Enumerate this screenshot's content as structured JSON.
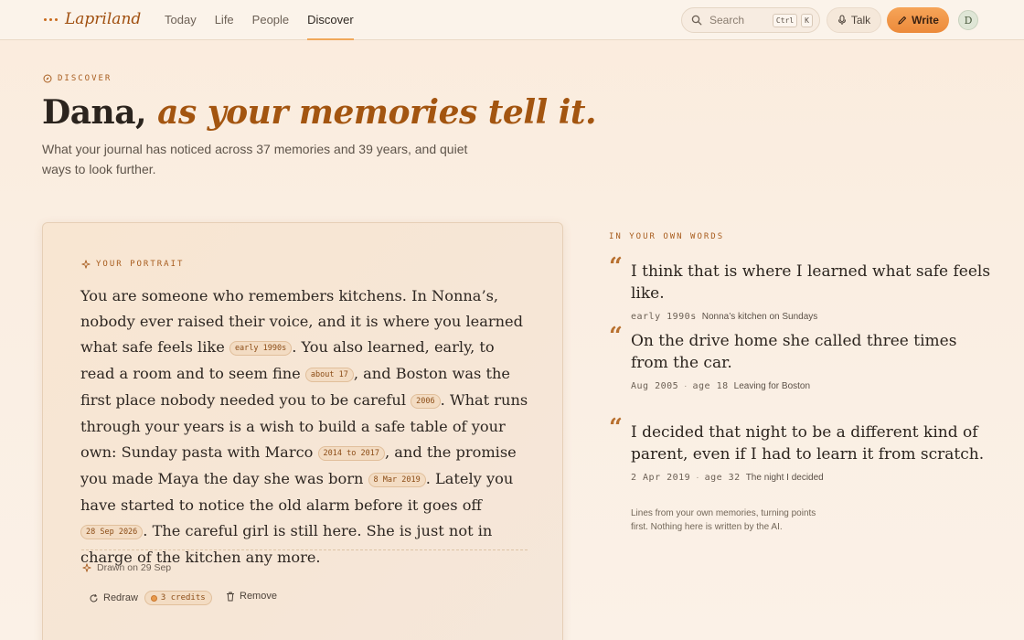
{
  "header": {
    "brand": "Lapriland",
    "nav": [
      {
        "label": "Today"
      },
      {
        "label": "Life"
      },
      {
        "label": "People"
      },
      {
        "label": "Discover",
        "active": true
      }
    ],
    "search": {
      "placeholder": "Search",
      "shortcut_ctrl": "Ctrl",
      "shortcut_key": "K",
      "icon": "search-icon"
    },
    "talk_label": "Talk",
    "write_label": "Write",
    "avatar_initial": "D"
  },
  "hero": {
    "eyebrow": "DISCOVER",
    "title_name": "Dana,",
    "title_emphasis": "as your memories tell it.",
    "subtitle": "What your journal has noticed across 37 memories and 39 years, and quiet ways to look further."
  },
  "portrait": {
    "eyebrow": "YOUR PORTRAIT",
    "text": [
      "You are someone who remembers kitchens. In Nonna’s, nobody ever raised their voice, and it is where you learned what safe feels like ",
      ". You also learned, early, to read a room and to seem fine ",
      ", and Boston was the first place nobody needed you to be careful ",
      ". What runs through your years is a wish to build a safe table of your own: Sunday pasta with Marco ",
      ", and the promise you made Maya the day she was born ",
      ". Lately you have started to notice the old alarm before it goes off ",
      ". The careful girl is still here. She is just not in charge of the kitchen any more."
    ],
    "chips": [
      "early 1990s",
      "about 17",
      "2006",
      "2014 to 2017",
      "8 Mar 2019",
      "28 Sep 2026"
    ],
    "drawn_on": "Drawn on 29 Sep",
    "redraw_label": "Redraw",
    "credits_label": "3 credits",
    "remove_label": "Remove"
  },
  "words": {
    "eyebrow": "IN YOUR OWN WORDS",
    "quotes": [
      {
        "text": "I think that is where I learned what safe feels like.",
        "date": "early 1990s",
        "age": "",
        "source": "Nonna’s kitchen on Sundays"
      },
      {
        "text": "On the drive home she called three times from the car.",
        "date": "Aug 2005",
        "age": "age 18",
        "source": "Leaving for Boston"
      },
      {
        "text": "I decided that night to be a different kind of parent, even if I had to learn it from scratch.",
        "date": "2 Apr 2019",
        "age": "age 32",
        "source": "The night I decided"
      }
    ],
    "note": "Lines from your own memories, turning points first. Nothing here is written by the AI."
  },
  "colors": {
    "accent": "#a35510",
    "write_button": "#ec8a3a",
    "chip_bg": "#f3dcc3"
  }
}
